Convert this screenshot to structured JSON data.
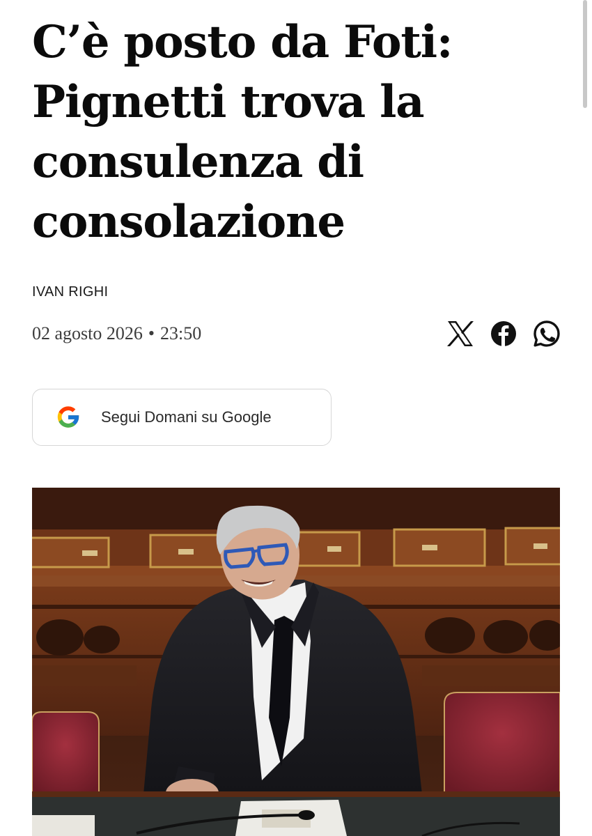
{
  "article": {
    "headline": "C’è posto da Foti: Pignetti trova la consulenza di consolazione",
    "author": "IVAN RIGHI",
    "date": "02 agosto 2026",
    "separator": "•",
    "time": "23:50"
  },
  "share": {
    "icons": [
      "x-icon",
      "facebook-icon",
      "whatsapp-icon"
    ]
  },
  "follow": {
    "label": "Segui Domani su Google",
    "icon": "google-icon"
  },
  "photo": {
    "subject": "man in dark suit with blue glasses smiling in parliament benches"
  },
  "colors": {
    "text": "#0b0b0b",
    "meta": "#3c3c3c",
    "border": "#d6d6d6",
    "wood": "#5a2a14",
    "seat_red": "#8a2230"
  }
}
